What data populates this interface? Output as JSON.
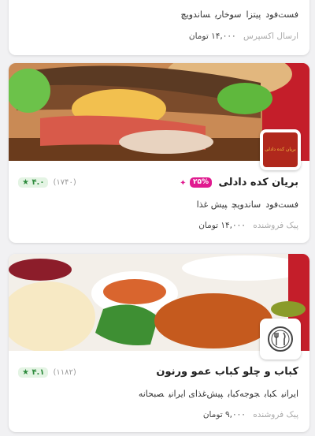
{
  "restaurants": [
    {
      "tags": [
        "فست‌فود",
        "پیتزا",
        "سوخاری",
        "ساندویچ"
      ],
      "delivery_type": "ارسال اکسپرس",
      "delivery_price": "۱۴,۰۰۰ تومان"
    },
    {
      "name": "بریان کده دادلی",
      "discount": "۲۵%",
      "rating": "۴.۰",
      "rating_count": "(۱۷۴۰)",
      "tags": [
        "فست‌فود",
        "ساندویچ",
        "پیش غذا"
      ],
      "delivery_type": "پیک فروشنده",
      "delivery_price": "۱۴,۰۰۰ تومان",
      "logo_text": "بریان کده دادلی",
      "logo_icon": "restaurant-logo"
    },
    {
      "name": "کباب و چلو کباب عمو ورنون",
      "rating": "۴.۱",
      "rating_count": "(۱۱۸۲)",
      "tags": [
        "ایرانی",
        "کباب",
        "جوجه‌کباب",
        "پیش‌غذای ایرانی",
        "صبحانه"
      ],
      "delivery_type": "پیک فروشنده",
      "delivery_price": "۹,۰۰۰ تومان",
      "logo_icon": "cutlery-icon"
    }
  ],
  "colors": {
    "discount": "#e01a8f",
    "rating_bg": "#e4f4e4",
    "rating_fg": "#2e8b3d"
  }
}
